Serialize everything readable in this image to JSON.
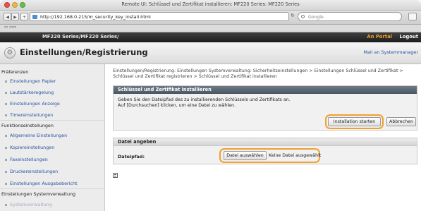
{
  "window": {
    "title": "Remote UI: Schlüssel und Zertifikat installieren: MF220 Series: MF220 Series"
  },
  "browser": {
    "url": "http://192.168.0.215/m_security_key_install.html",
    "search_placeholder": "Google",
    "back_icon": "back-arrow-icon",
    "forward_icon": "forward-arrow-icon"
  },
  "device_header": {
    "model": "MF220 Series/MF220 Series/",
    "portal_link": "An Portal",
    "logout_link": "Logout"
  },
  "page": {
    "title": "Einstellungen/Registrierung",
    "mail_link": "Mail an Systemmanager"
  },
  "sidebar": {
    "sections": [
      {
        "label": "Präferenzen",
        "items": [
          "Einstellungen Papier",
          "Lautstärkeregelung",
          "Einstellungen Anzeige",
          "Timereinstellungen"
        ]
      },
      {
        "label": "Funktionseinstellungen",
        "items": [
          "Allgemeine Einstellungen",
          "Kopiereinstellungen",
          "Faxeinstellungen",
          "Druckereinstellungen",
          "Einstellungen Ausgabebericht"
        ]
      },
      {
        "label": "Einstellungen Systemverwaltung",
        "items": [
          "Systemverwaltung"
        ]
      }
    ]
  },
  "main": {
    "breadcrumb": "Einstellungen/Registrierung: Einstellungen Systemverwaltung: Sicherheitseinstellungen > Einstellungen Schlüssel und Zertifikat > Schlüssel und Zertifikat registrieren > Schlüssel und Zertifikat installieren",
    "install_panel": {
      "title": "Schlüssel und Zertifikat installieren",
      "instruction_line1": "Geben Sie den Dateipfad des zu installierenden Schlüssels und Zertifikats an.",
      "instruction_line2": "Auf [Durchsuchen] klicken, um eine Datei zu wählen.",
      "start_button": "Installation starten",
      "cancel_button": "Abbrechen"
    },
    "file_panel": {
      "title": "Datei angeben",
      "field_label": "Dateipfad:",
      "choose_button": "Datei auswählen",
      "no_file_text": "Keine Datei ausgewählt"
    }
  },
  "colors": {
    "highlight": "#f0a030",
    "panel_header": "#4a5562",
    "link": "#2a52a0"
  }
}
